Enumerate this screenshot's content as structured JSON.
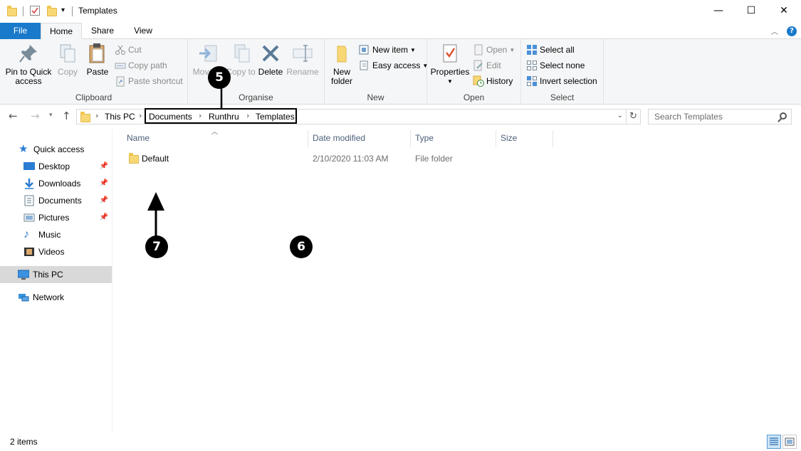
{
  "window": {
    "title": "Templates",
    "minimize_glyph": "—",
    "maximize_glyph": "☐",
    "close_glyph": "✕"
  },
  "tabs": {
    "file": "File",
    "home": "Home",
    "share": "Share",
    "view": "View"
  },
  "ribbon": {
    "clipboard": {
      "label": "Clipboard",
      "pin_to_quick_access": "Pin to Quick access",
      "copy": "Copy",
      "paste": "Paste",
      "cut": "Cut",
      "copy_path": "Copy path",
      "paste_shortcut": "Paste shortcut"
    },
    "organise": {
      "label": "Organise",
      "move_to": "Move to",
      "copy_to": "Copy to",
      "delete": "Delete",
      "rename": "Rename"
    },
    "new": {
      "label": "New",
      "new_folder": "New folder",
      "new_item": "New item",
      "easy_access": "Easy access"
    },
    "open": {
      "label": "Open",
      "properties": "Properties",
      "open": "Open",
      "edit": "Edit",
      "history": "History"
    },
    "select": {
      "label": "Select",
      "select_all": "Select all",
      "select_none": "Select none",
      "invert_selection": "Invert selection"
    }
  },
  "address": {
    "this_pc": "This PC",
    "crumbs": [
      "Documents",
      "Runthru",
      "Templates"
    ],
    "search_placeholder": "Search Templates"
  },
  "nav": {
    "quick_access": "Quick access",
    "desktop": "Desktop",
    "downloads": "Downloads",
    "documents": "Documents",
    "pictures": "Pictures",
    "music": "Music",
    "videos": "Videos",
    "this_pc": "This PC",
    "network": "Network"
  },
  "columns": {
    "name": "Name",
    "date_modified": "Date modified",
    "type": "Type",
    "size": "Size"
  },
  "files": [
    {
      "name": "Default",
      "date_modified": "2/10/2020 11:03 AM",
      "type": "File folder",
      "size": ""
    }
  ],
  "callouts": {
    "five": "5",
    "six": "6",
    "seven": "7"
  },
  "status": {
    "item_count": "2 items"
  },
  "colors": {
    "accent": "#1979ca",
    "selected_nav": "#d9d9d9",
    "folder": "#f8d775"
  }
}
